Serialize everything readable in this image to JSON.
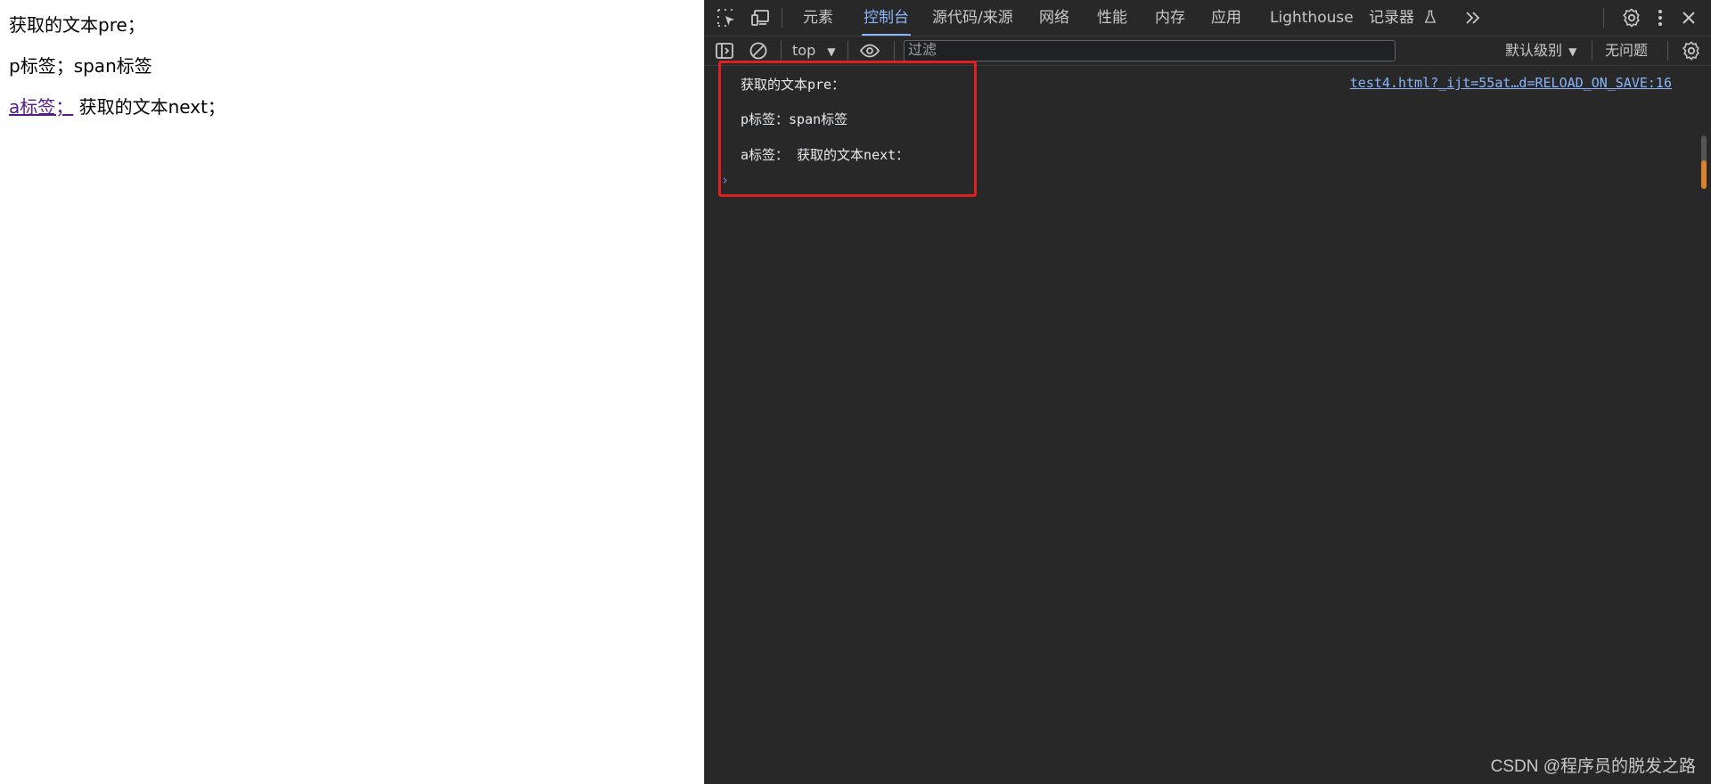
{
  "page": {
    "line1": "获取的文本pre；",
    "line2": "p标签；span标签",
    "link_text": "a标签；",
    "line3_rest": "获取的文本next；"
  },
  "devtools": {
    "tabs": [
      {
        "label": "元素"
      },
      {
        "label": "控制台"
      },
      {
        "label": "源代码/来源"
      },
      {
        "label": "网络"
      },
      {
        "label": "性能"
      },
      {
        "label": "内存"
      },
      {
        "label": "应用"
      },
      {
        "label": "Lighthouse"
      },
      {
        "label": "记录器"
      }
    ],
    "active_tab": "控制台",
    "toolbar": {
      "context": "top",
      "filter_placeholder": "过滤",
      "levels": "默认级别",
      "issues": "无问题"
    },
    "console": {
      "messages": [
        {
          "text": "获取的文本pre："
        },
        {
          "text": "p标签：span标签"
        },
        {
          "text": "a标签：  获取的文本next："
        }
      ],
      "source_link": "test4.html?_ijt=55at…d=RELOAD_ON_SAVE:16"
    }
  },
  "watermark": "CSDN @程序员的脱发之路",
  "colors": {
    "devtools_bg": "#282828",
    "accent": "#8ab4f8",
    "highlight": "#e02020",
    "link_visited": "#551a8b"
  }
}
